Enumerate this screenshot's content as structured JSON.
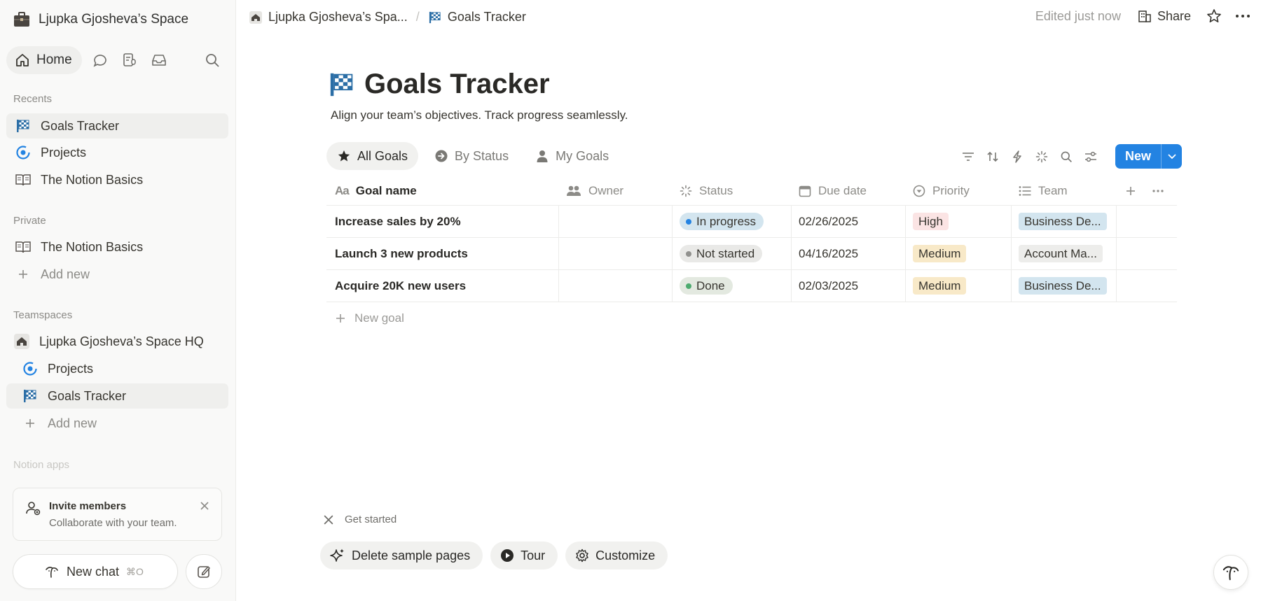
{
  "workspace": {
    "name": "Ljupka Gjosheva’s Space"
  },
  "nav": {
    "home_label": "Home"
  },
  "sidebar": {
    "recents_label": "Recents",
    "recents": [
      {
        "label": "Goals Tracker",
        "icon": "checkered-flag-icon"
      },
      {
        "label": "Projects",
        "icon": "projects-target-icon"
      },
      {
        "label": "The Notion Basics",
        "icon": "open-book-icon"
      }
    ],
    "private_label": "Private",
    "private": [
      {
        "label": "The Notion Basics",
        "icon": "open-book-icon"
      },
      {
        "label": "Add new",
        "icon": "plus-icon"
      }
    ],
    "teamspaces_label": "Teamspaces",
    "teamspace_name": "Ljupka Gjosheva’s Space HQ",
    "teamspace_items": [
      {
        "label": "Projects",
        "icon": "projects-target-icon"
      },
      {
        "label": "Goals Tracker",
        "icon": "checkered-flag-icon"
      },
      {
        "label": "Add new",
        "icon": "plus-icon"
      }
    ],
    "apps_label": "Notion apps"
  },
  "invite": {
    "title": "Invite members",
    "subtitle": "Collaborate with your team."
  },
  "newchat": {
    "label": "New chat",
    "shortcut": "⌘O"
  },
  "breadcrumb": {
    "space": "Ljupka Gjosheva’s Spa...",
    "separator": "/",
    "page": "Goals Tracker"
  },
  "topbar": {
    "edited": "Edited just now",
    "share": "Share"
  },
  "page": {
    "title": "Goals Tracker",
    "description": "Align your team’s objectives. Track progress seamlessly."
  },
  "views": [
    {
      "label": "All Goals",
      "active": true
    },
    {
      "label": "By Status",
      "active": false
    },
    {
      "label": "My Goals",
      "active": false
    }
  ],
  "new_button": "New",
  "table": {
    "headers": [
      "Goal name",
      "Owner",
      "Status",
      "Due date",
      "Priority",
      "Team"
    ],
    "rows": [
      {
        "goal": "Increase sales by 20%",
        "owner": "",
        "status": "In progress",
        "due": "02/26/2025",
        "priority": "High",
        "team": "Business De..."
      },
      {
        "goal": "Launch 3 new products",
        "owner": "",
        "status": "Not started",
        "due": "04/16/2025",
        "priority": "Medium",
        "team": "Account Ma..."
      },
      {
        "goal": "Acquire 20K new users",
        "owner": "",
        "status": "Done",
        "due": "02/03/2025",
        "priority": "Medium",
        "team": "Business De..."
      }
    ],
    "new_row_label": "New goal"
  },
  "get_started": {
    "label": "Get started",
    "buttons": [
      "Delete sample pages",
      "Tour",
      "Customize"
    ]
  },
  "colors": {
    "accent": "#2383e2",
    "status_in_progress_bg": "#d3e5ef",
    "status_in_progress_dot": "#2383e2",
    "status_not_started_bg": "#e9e9e7",
    "status_not_started_dot": "#91918e",
    "status_done_bg": "#e3e9e0",
    "status_done_dot": "#4dab6f",
    "priority_high_bg": "#fbe4e4",
    "priority_medium_bg": "#f8e9c8",
    "team_business_bg": "#d3e5ef",
    "team_account_bg": "#ededeb"
  }
}
